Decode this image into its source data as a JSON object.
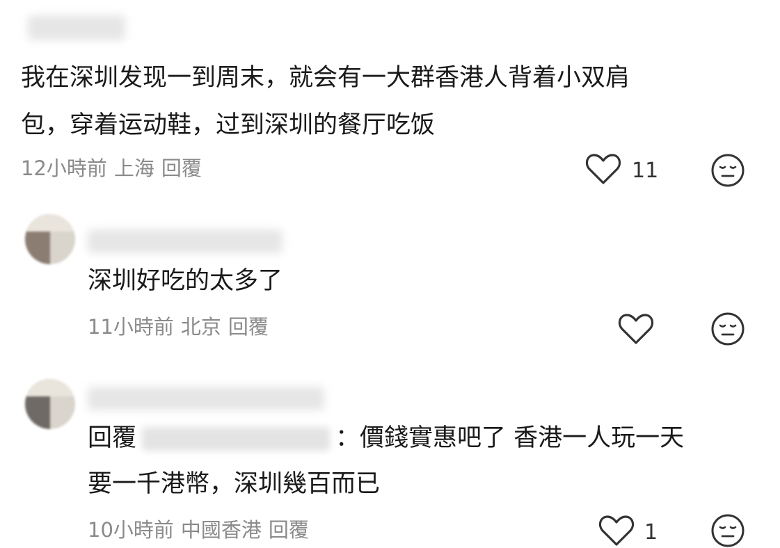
{
  "comments": [
    {
      "text_lines": [
        "我在深圳发现一到周末，就会有一大群香港人背着小双肩",
        "包，穿着运动鞋，过到深圳的餐厅吃饭"
      ],
      "time": "12小時前",
      "location": "上海",
      "reply_label": "回覆",
      "likes": "11"
    },
    {
      "text_lines": [
        "深圳好吃的太多了"
      ],
      "time": "11小時前",
      "location": "北京",
      "reply_label": "回覆",
      "likes": ""
    },
    {
      "reply_prefix": "回覆",
      "reply_suffix": "：價錢實惠吧了 香港一人玩一天",
      "text_lines": [
        "要一千港幣，深圳幾百而已"
      ],
      "time": "10小時前",
      "location": "中國香港",
      "reply_label": "回覆",
      "likes": "1"
    }
  ],
  "icons": {
    "like": "heart-outline-icon",
    "dislike": "neutral-face-icon"
  },
  "colors": {
    "text": "#1a1a1a",
    "meta": "#8a8a8a",
    "icon": "#333333"
  }
}
